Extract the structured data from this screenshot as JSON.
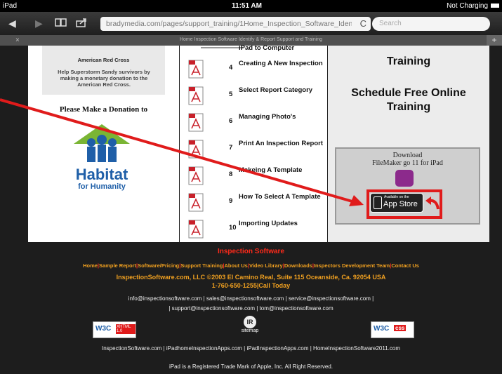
{
  "status": {
    "device": "iPad",
    "time": "11:51 AM",
    "battery": "Not Charging"
  },
  "browser": {
    "url": "bradymedia.com/pages/support_training/1Home_Inspection_Software_Ident",
    "search_placeholder": "Search",
    "tab_title": "Home Inspection Software Identify & Report Support and Training",
    "back_icon": "◀",
    "forward_icon": "▶",
    "bookmarks_icon": "📖",
    "share_icon": "share",
    "reload_icon": "C",
    "close_tab": "×",
    "new_tab": "+"
  },
  "left": {
    "redcross_title": "American Red Cross",
    "redcross_text": "Help Superstorm Sandy survivors by making a monetary donation to the American Red Cross.",
    "donation_heading": "Please Make a Donation to",
    "habitat_name": "Habitat",
    "habitat_sub": "for Humanity"
  },
  "training_list": [
    {
      "num": "4",
      "label": "Creating A New Inspection"
    },
    {
      "num": "5",
      "label": "Select Report Category"
    },
    {
      "num": "6",
      "label": "Managing Photo's"
    },
    {
      "num": "7",
      "label": "Print An Inspection Report"
    },
    {
      "num": "8",
      "label": "Makeing A Template"
    },
    {
      "num": "9",
      "label": "How To Select A Template"
    },
    {
      "num": "10",
      "label": "Importing Updates"
    }
  ],
  "top_partial_label": "iPad to Computer",
  "right": {
    "training_heading": "Training",
    "schedule_heading": "Schedule Free Online Training",
    "download_label": "Download",
    "filemaker_label": "FileMaker go 11 for iPad",
    "appstore_small": "Available on the",
    "appstore_big": "App Store"
  },
  "footer": {
    "section_title": "Inspection Software",
    "nav": [
      "Home",
      "Sample Report",
      "Software/Pricing",
      "Support Training",
      "About Us",
      "Video Library",
      "Downloads",
      "Inspectors Development Team",
      "Contact Us"
    ],
    "company_line1": "InspectionSoftware.com, LLC ©2003 El Camino Real, Suite 115 Oceanside, Ca. 92054 USA",
    "company_line2": "1-760-650-1255|Call Today",
    "emails_line1": "info@inspectionsoftware.com | sales@inspectionsoftware.com | service@inspectionsoftware.com |",
    "emails_line2": "| support@inspectionsoftware.com | tom@inspectionsoftware.com",
    "w3c_xhtml": "XHTML 1.0",
    "w3c_css": "css",
    "sitemap_label": "sitemap",
    "sites": "InspectionSoftware.com | iPadhomeInspectionApps.com | iPadInspectionApps.com | HomeInspectionSoftware2011.com",
    "trademark": "iPad is a Registered Trade Mark of Apple, Inc. All Right Reserved."
  },
  "colors": {
    "accent_red": "#e01b1b",
    "footer_orange": "#f0a020",
    "footer_title_red": "#ff2a1a",
    "pdf_red": "#c8202a"
  }
}
